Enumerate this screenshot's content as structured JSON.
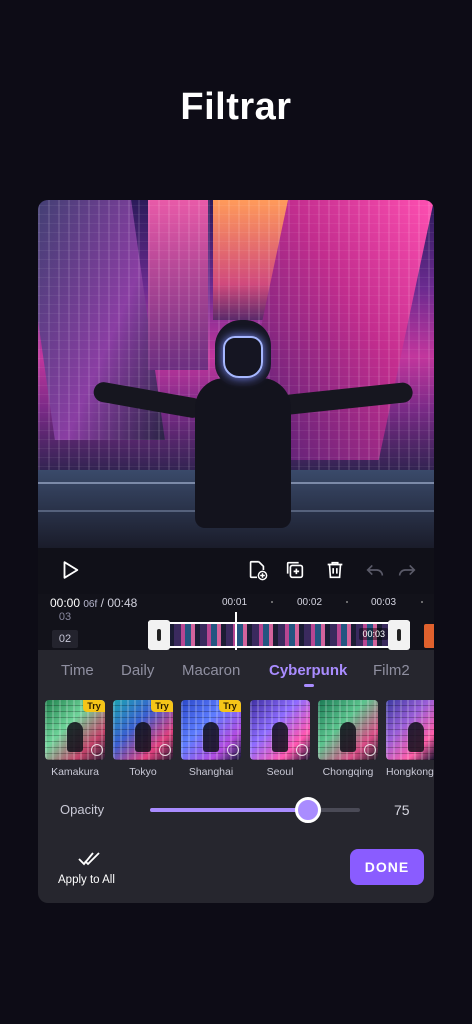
{
  "page": {
    "title": "Filtrar"
  },
  "timeline": {
    "current_time": "00:00",
    "current_frame": "06f",
    "separator": "/",
    "total_time": "00:48",
    "ticks": [
      "00:01",
      "00:02",
      "00:03"
    ],
    "tracks": [
      "03",
      "02"
    ],
    "clip_duration": "00:03"
  },
  "filters": {
    "tabs": [
      "Time",
      "Daily",
      "Macaron",
      "Cyberpunk",
      "Film2"
    ],
    "active_tab": "Cyberpunk",
    "items": [
      {
        "label": "Kamakura",
        "badge": "Try"
      },
      {
        "label": "Tokyo",
        "badge": "Try"
      },
      {
        "label": "Shanghai",
        "badge": "Try"
      },
      {
        "label": "Seoul",
        "badge": ""
      },
      {
        "label": "Chongqing",
        "badge": ""
      },
      {
        "label": "Hongkong",
        "badge": ""
      }
    ]
  },
  "opacity": {
    "label": "Opacity",
    "value": "75",
    "fraction": 0.75
  },
  "actions": {
    "apply_all": "Apply to All",
    "done": "DONE"
  },
  "colors": {
    "accent": "#a98cff",
    "done_button": "#8a5cff",
    "try_badge": "#f5c518"
  },
  "icons": {
    "play": "play-icon",
    "add_clip": "add-clip-icon",
    "duplicate": "duplicate-icon",
    "delete": "trash-icon",
    "undo": "undo-icon",
    "redo": "redo-icon",
    "apply_all": "double-check-icon"
  }
}
